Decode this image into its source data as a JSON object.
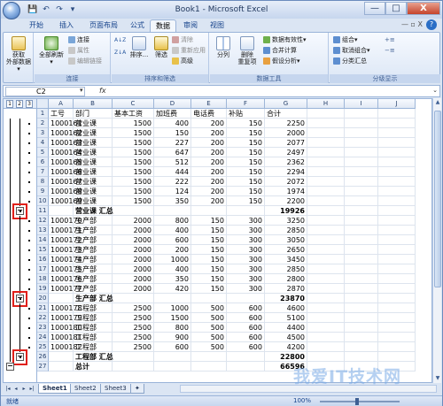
{
  "window": {
    "title": "Book1 - Microsoft Excel",
    "controls": {
      "minimize": "—",
      "maximize": "□",
      "close": "X"
    }
  },
  "qat": {
    "save": "💾",
    "undo": "↶",
    "redo": "↷",
    "customize": "▾"
  },
  "tabs": [
    "开始",
    "插入",
    "页面布局",
    "公式",
    "数据",
    "审阅",
    "视图"
  ],
  "active_tab": "数据",
  "ribbon_controls": {
    "minimize": "—  ▫  X"
  },
  "ribbon": {
    "groups": [
      {
        "label": "",
        "big": [
          "获取",
          "外部数据▾"
        ]
      },
      {
        "label": "连接",
        "big": [
          "全部刷新",
          "▾"
        ],
        "small": [
          "连接",
          "属性",
          "编辑链接"
        ]
      },
      {
        "label": "排序和筛选",
        "big_sort": "排序...",
        "big_filter": "筛选",
        "small": [
          "清除",
          "重新应用",
          "高级"
        ]
      },
      {
        "label": "数据工具",
        "big": [
          "分列",
          "删除",
          "重复项"
        ],
        "small": [
          "数据有效性▾",
          "合并计算",
          "假设分析▾"
        ]
      },
      {
        "label": "分级显示",
        "small": [
          "组合▾",
          "取消组合▾",
          "分类汇总"
        ]
      }
    ],
    "sort_icons": [
      "A↓Z",
      "Z↓A"
    ]
  },
  "formula_bar": {
    "name_box": "C2",
    "fx": "fx",
    "value": ""
  },
  "outline_levels": [
    "1",
    "2",
    "3"
  ],
  "columns": [
    "A",
    "B",
    "C",
    "D",
    "E",
    "F",
    "G",
    "H",
    "I",
    "J"
  ],
  "rows": [
    {
      "n": "1",
      "a": "工号",
      "b": "部门",
      "c": "基本工资",
      "d": "加班费",
      "e": "电话费",
      "f": "补贴",
      "g": "合计",
      "bold": false,
      "header": true
    },
    {
      "n": "2",
      "a": "1000161",
      "b": "营业课",
      "c": "1500",
      "d": "400",
      "e": "200",
      "f": "150",
      "g": "2250"
    },
    {
      "n": "3",
      "a": "1000162",
      "b": "营业课",
      "c": "1500",
      "d": "150",
      "e": "200",
      "f": "150",
      "g": "2000"
    },
    {
      "n": "4",
      "a": "1000163",
      "b": "营业课",
      "c": "1500",
      "d": "227",
      "e": "200",
      "f": "150",
      "g": "2077"
    },
    {
      "n": "5",
      "a": "1000164",
      "b": "营业课",
      "c": "1500",
      "d": "647",
      "e": "200",
      "f": "150",
      "g": "2497"
    },
    {
      "n": "6",
      "a": "1000165",
      "b": "营业课",
      "c": "1500",
      "d": "512",
      "e": "200",
      "f": "150",
      "g": "2362"
    },
    {
      "n": "7",
      "a": "1000166",
      "b": "营业课",
      "c": "1500",
      "d": "444",
      "e": "200",
      "f": "150",
      "g": "2294"
    },
    {
      "n": "8",
      "a": "1000167",
      "b": "营业课",
      "c": "1500",
      "d": "222",
      "e": "200",
      "f": "150",
      "g": "2072"
    },
    {
      "n": "9",
      "a": "1000168",
      "b": "营业课",
      "c": "1500",
      "d": "124",
      "e": "200",
      "f": "150",
      "g": "1974"
    },
    {
      "n": "10",
      "a": "1000169",
      "b": "营业课",
      "c": "1500",
      "d": "350",
      "e": "200",
      "f": "150",
      "g": "2200"
    },
    {
      "n": "11",
      "a": "",
      "b": "营业课 汇总",
      "c": "",
      "d": "",
      "e": "",
      "f": "",
      "g": "19926",
      "bold": true
    },
    {
      "n": "12",
      "a": "1000170",
      "b": "生产部",
      "c": "2000",
      "d": "800",
      "e": "150",
      "f": "300",
      "g": "3250"
    },
    {
      "n": "13",
      "a": "1000171",
      "b": "生产部",
      "c": "2000",
      "d": "400",
      "e": "150",
      "f": "300",
      "g": "2850"
    },
    {
      "n": "14",
      "a": "1000172",
      "b": "生产部",
      "c": "2000",
      "d": "600",
      "e": "150",
      "f": "300",
      "g": "3050"
    },
    {
      "n": "15",
      "a": "1000173",
      "b": "生产部",
      "c": "2000",
      "d": "200",
      "e": "150",
      "f": "300",
      "g": "2650"
    },
    {
      "n": "16",
      "a": "1000174",
      "b": "生产部",
      "c": "2000",
      "d": "1000",
      "e": "150",
      "f": "300",
      "g": "3450"
    },
    {
      "n": "17",
      "a": "1000175",
      "b": "生产部",
      "c": "2000",
      "d": "400",
      "e": "150",
      "f": "300",
      "g": "2850"
    },
    {
      "n": "18",
      "a": "1000176",
      "b": "生产部",
      "c": "2000",
      "d": "350",
      "e": "150",
      "f": "300",
      "g": "2800"
    },
    {
      "n": "19",
      "a": "1000177",
      "b": "生产部",
      "c": "2000",
      "d": "420",
      "e": "150",
      "f": "300",
      "g": "2870"
    },
    {
      "n": "20",
      "a": "",
      "b": "生产部 汇总",
      "c": "",
      "d": "",
      "e": "",
      "f": "",
      "g": "23870",
      "bold": true
    },
    {
      "n": "21",
      "a": "1000178",
      "b": "工程部",
      "c": "2500",
      "d": "1000",
      "e": "500",
      "f": "600",
      "g": "4600"
    },
    {
      "n": "22",
      "a": "1000179",
      "b": "工程部",
      "c": "2500",
      "d": "1500",
      "e": "500",
      "f": "600",
      "g": "5100"
    },
    {
      "n": "23",
      "a": "1000180",
      "b": "工程部",
      "c": "2500",
      "d": "800",
      "e": "500",
      "f": "600",
      "g": "4400"
    },
    {
      "n": "24",
      "a": "1000181",
      "b": "工程部",
      "c": "2500",
      "d": "900",
      "e": "500",
      "f": "600",
      "g": "4500"
    },
    {
      "n": "25",
      "a": "1000182",
      "b": "工程部",
      "c": "2500",
      "d": "600",
      "e": "500",
      "f": "600",
      "g": "4200"
    },
    {
      "n": "26",
      "a": "",
      "b": "工程部 汇总",
      "c": "",
      "d": "",
      "e": "",
      "f": "",
      "g": "22800",
      "bold": true
    },
    {
      "n": "27",
      "a": "",
      "b": "总计",
      "c": "",
      "d": "",
      "e": "",
      "f": "",
      "g": "66596",
      "bold": true
    }
  ],
  "sheet_tabs": [
    "Sheet1",
    "Sheet2",
    "Sheet3"
  ],
  "active_sheet": "Sheet1",
  "status": {
    "ready": "就绪",
    "zoom": "100%",
    "zoom_level": 1.0
  },
  "watermark": "我爱IT技术网",
  "colors": {
    "accent": "#15428b",
    "highlight": "#e0201a",
    "ribbon_bg": "#dbe6f5"
  }
}
